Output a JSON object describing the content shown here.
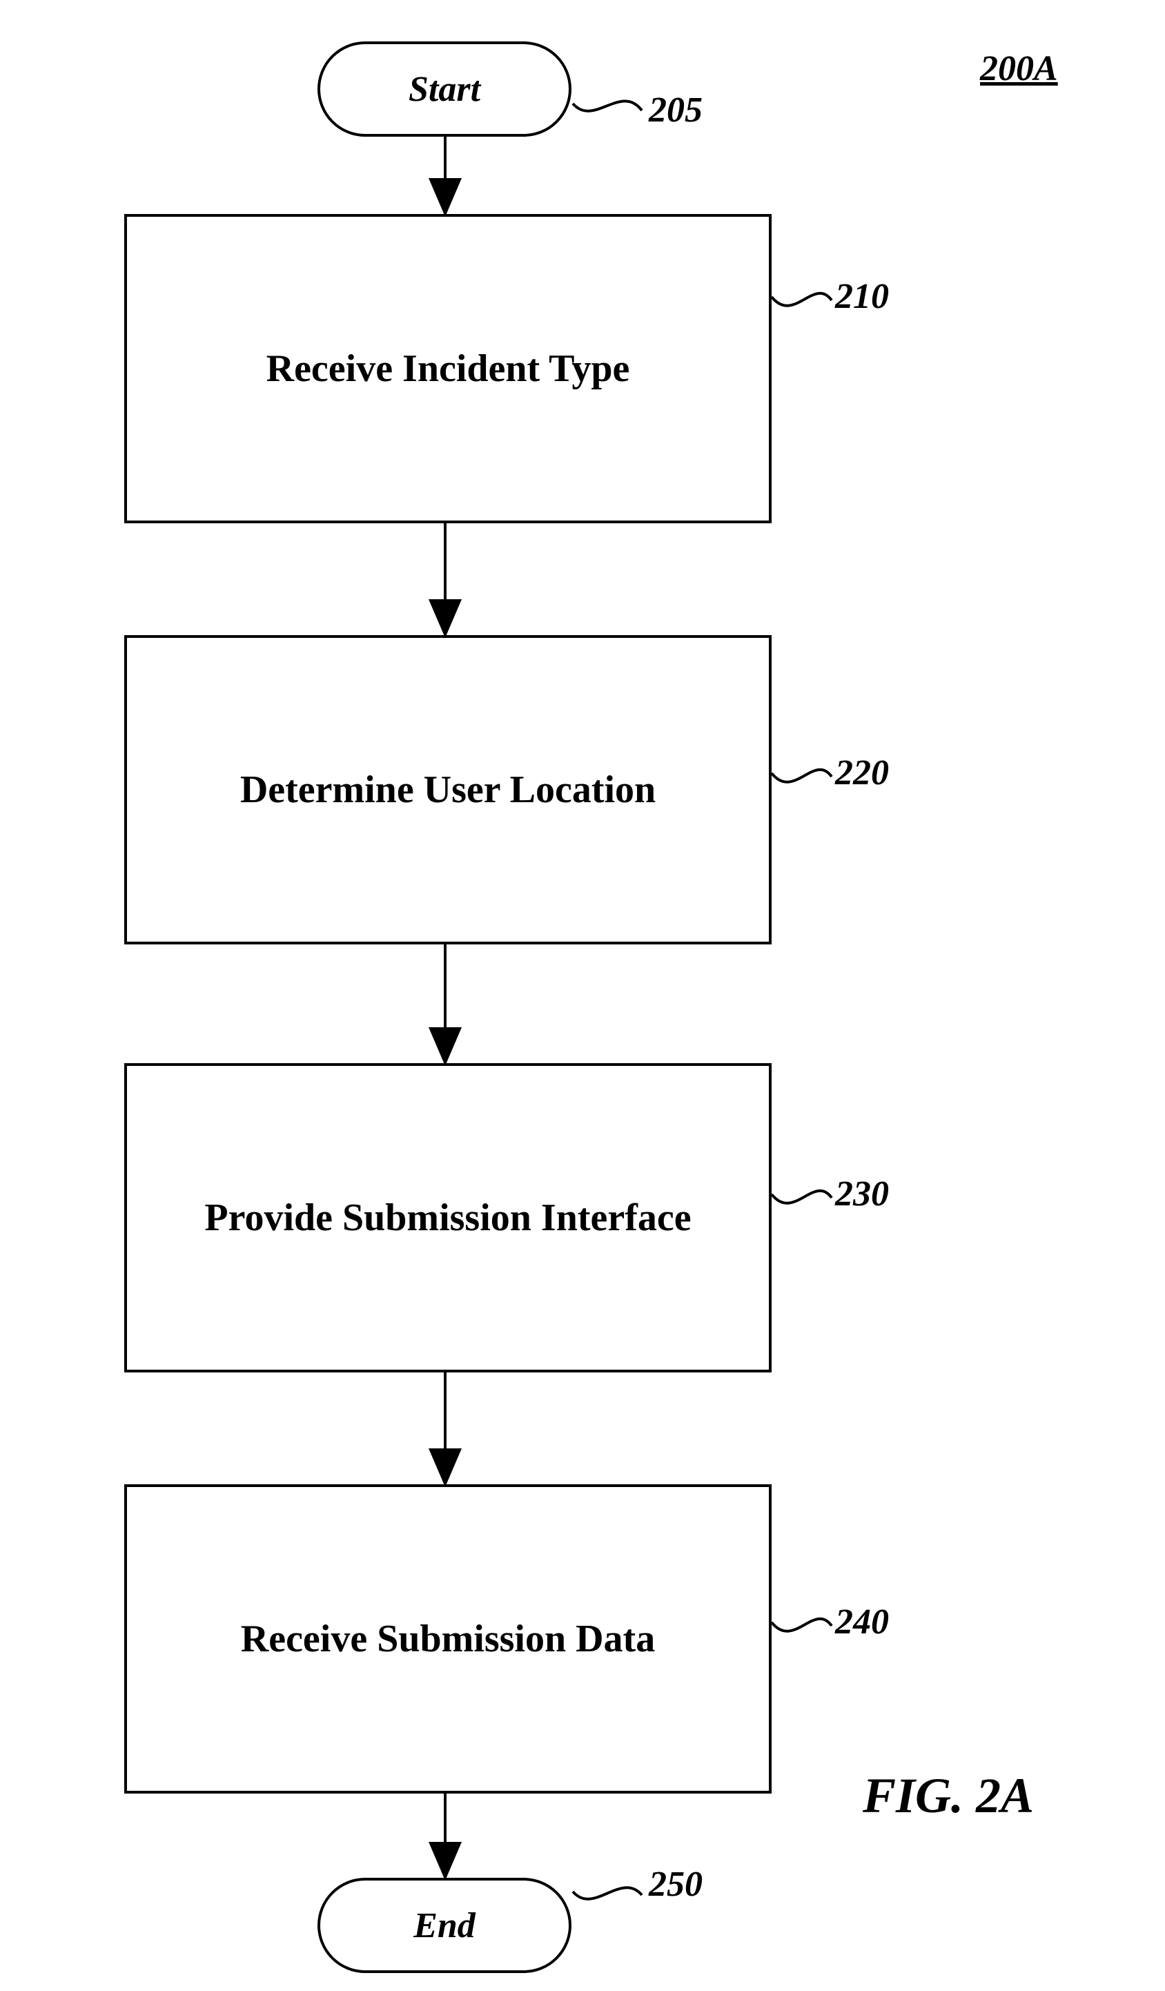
{
  "page_label": "200A",
  "figure_label": "FIG. 2A",
  "nodes": {
    "start": {
      "label": "Start",
      "ref": "205"
    },
    "step1": {
      "label": "Receive Incident Type",
      "ref": "210"
    },
    "step2": {
      "label": "Determine User Location",
      "ref": "220"
    },
    "step3": {
      "label": "Provide Submission Interface",
      "ref": "230"
    },
    "step4": {
      "label": "Receive Submission Data",
      "ref": "240"
    },
    "end": {
      "label": "End",
      "ref": "250"
    }
  }
}
